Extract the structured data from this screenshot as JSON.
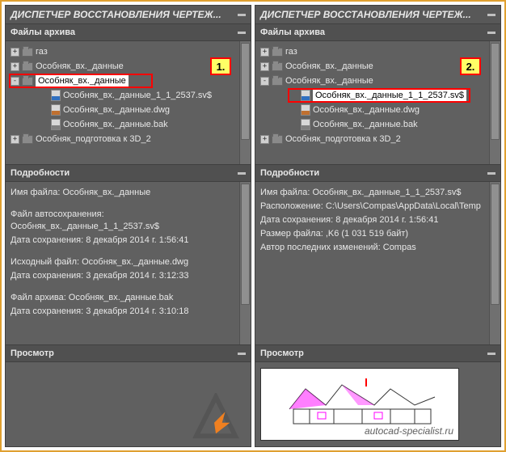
{
  "panel_title": "ДИСПЕТЧЕР ВОССТАНОВЛЕНИЯ ЧЕРТЕЖ...",
  "sections": {
    "archive": "Файлы архива",
    "details": "Подробности",
    "preview": "Просмотр"
  },
  "badges": {
    "left": "1.",
    "right": "2."
  },
  "left": {
    "tree": [
      {
        "exp": "+",
        "type": "folder",
        "label": "газ",
        "indent": 0
      },
      {
        "exp": "+",
        "type": "folder",
        "label": "Особняк_вх._данные",
        "indent": 0
      },
      {
        "exp": "-",
        "type": "folder",
        "label": "Особняк_вх._данные",
        "indent": 0,
        "selected": true
      },
      {
        "exp": "",
        "type": "svs",
        "label": "Особняк_вх._данные_1_1_2537.sv$",
        "indent": 2
      },
      {
        "exp": "",
        "type": "dwg",
        "label": "Особняк_вх._данные.dwg",
        "indent": 2
      },
      {
        "exp": "",
        "type": "bak",
        "label": "Особняк_вх._данные.bak",
        "indent": 2
      },
      {
        "exp": "+",
        "type": "folder",
        "label": "Особняк_подготовка к 3D_2",
        "indent": 0
      }
    ],
    "details": {
      "l1": "Имя файла: Особняк_вх._данные",
      "l2": "Файл автосохранения: Особняк_вх._данные_1_1_2537.sv$",
      "l3": "Дата сохранения: 8 декабря 2014 г.  1:56:41",
      "l4": "Исходный файл: Особняк_вх._данные.dwg",
      "l5": "Дата сохранения: 3 декабря 2014 г.  3:12:33",
      "l6": "Файл архива: Особняк_вх._данные.bak",
      "l7": "Дата сохранения: 3 декабря 2014 г.  3:10:18"
    }
  },
  "right": {
    "tree": [
      {
        "exp": "+",
        "type": "folder",
        "label": "газ",
        "indent": 0
      },
      {
        "exp": "+",
        "type": "folder",
        "label": "Особняк_вх._данные",
        "indent": 0
      },
      {
        "exp": "-",
        "type": "folder",
        "label": "Особняк_вх._данные",
        "indent": 0
      },
      {
        "exp": "",
        "type": "svs",
        "label": "Особняк_вх._данные_1_1_2537.sv$",
        "indent": 2,
        "selected": true
      },
      {
        "exp": "",
        "type": "dwg",
        "label": "Особняк_вх._данные.dwg",
        "indent": 2
      },
      {
        "exp": "",
        "type": "bak",
        "label": "Особняк_вх._данные.bak",
        "indent": 2
      },
      {
        "exp": "+",
        "type": "folder",
        "label": "Особняк_подготовка к 3D_2",
        "indent": 0
      }
    ],
    "details": {
      "l1": "Имя файла: Особняк_вх._данные_1_1_2537.sv$",
      "l2": "Расположение: C:\\Users\\Compas\\AppData\\Local\\Temp",
      "l3": "Дата сохранения: 8 декабря 2014 г.  1:56:41",
      "l4": "Размер файла: ,K6 (1 031 519 байт)",
      "l5": "Автор последних изменений: Compas"
    }
  },
  "watermark": "autocad-specialist.ru"
}
